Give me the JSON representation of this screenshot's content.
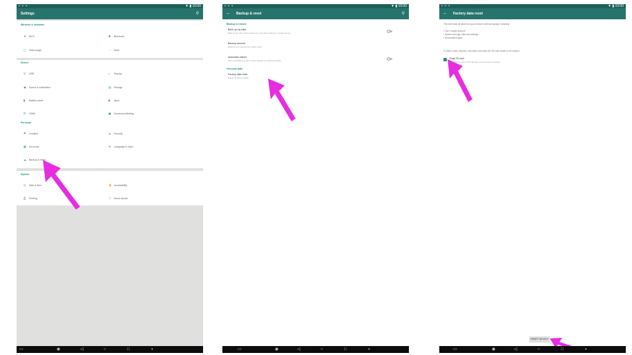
{
  "status": {
    "left_icons": "▪ ▪ ▪",
    "right_icons": "▼ ▮ 10:00"
  },
  "panel1": {
    "title": "Settings",
    "sections": [
      {
        "header": "Wireless & networks",
        "items": [
          {
            "icon": "▼",
            "label": "Wi-Fi"
          },
          {
            "icon": "✱",
            "label": "Bluetooth"
          },
          {
            "icon": "◯",
            "label": "Data usage"
          },
          {
            "icon": "⋯",
            "label": "More"
          }
        ]
      },
      {
        "header": "Device",
        "items": [
          {
            "icon": "⚲",
            "label": "USB"
          },
          {
            "icon": "◐",
            "label": "Display"
          },
          {
            "icon": "◀",
            "label": "Sound & notification"
          },
          {
            "icon": "▤",
            "label": "Storage"
          },
          {
            "icon": "▮",
            "label": "Battery saver"
          },
          {
            "icon": "▮",
            "label": "Apps"
          },
          {
            "icon": "⊡",
            "label": "HDMI"
          },
          {
            "icon": "▣",
            "label": "ScreenshotSetting"
          }
        ]
      },
      {
        "header": "Personal",
        "items": [
          {
            "icon": "⚑",
            "label": "Location"
          },
          {
            "icon": "▲",
            "label": "Security"
          },
          {
            "icon": "▦",
            "label": "Accounts"
          },
          {
            "icon": "⊕",
            "label": "Language & input"
          },
          {
            "icon": "☁",
            "label": "Backup & reset"
          }
        ]
      },
      {
        "header": "System",
        "items": [
          {
            "icon": "◷",
            "label": "Date & time"
          },
          {
            "icon": "✋",
            "label": "Accessibility"
          },
          {
            "icon": "⎙",
            "label": "Printing"
          },
          {
            "icon": "ⓘ",
            "label": "About device"
          }
        ]
      }
    ]
  },
  "panel2": {
    "title": "Backup & reset",
    "section1": "Backup & restore",
    "rows": [
      {
        "title": "Back up my data",
        "sub": "Back up app data, Wi-Fi passwords, and other settings to Google servers"
      },
      {
        "title": "Backup account",
        "sub": "Backing up to debug-only private cache"
      },
      {
        "title": "Automatic restore",
        "sub": "When reinstalling an app, restore backed up settings and data"
      }
    ],
    "section2": "Personal data",
    "reset_row": {
      "title": "Factory data reset",
      "sub": "Erases all data on tablet"
    }
  },
  "panel3": {
    "title": "Factory data reset",
    "lines": [
      "This will erase all data from your device's internal storage, including:",
      "• Your Google account",
      "• System and app data and settings",
      "• Downloaded apps",
      "To clear music, pictures, and other user data, the SD card needs to be erased."
    ],
    "checkbox": {
      "title": "Erase SD card",
      "sub": "Erase all the data on the SD card, such as music or photos"
    },
    "button": "RESET DEVICE"
  },
  "nav": {
    "icons": [
      "▭",
      "◉",
      "◁",
      "○",
      "□",
      "◑"
    ]
  },
  "colors": {
    "accent": "#27746d",
    "arrow": "#e62ee0"
  }
}
